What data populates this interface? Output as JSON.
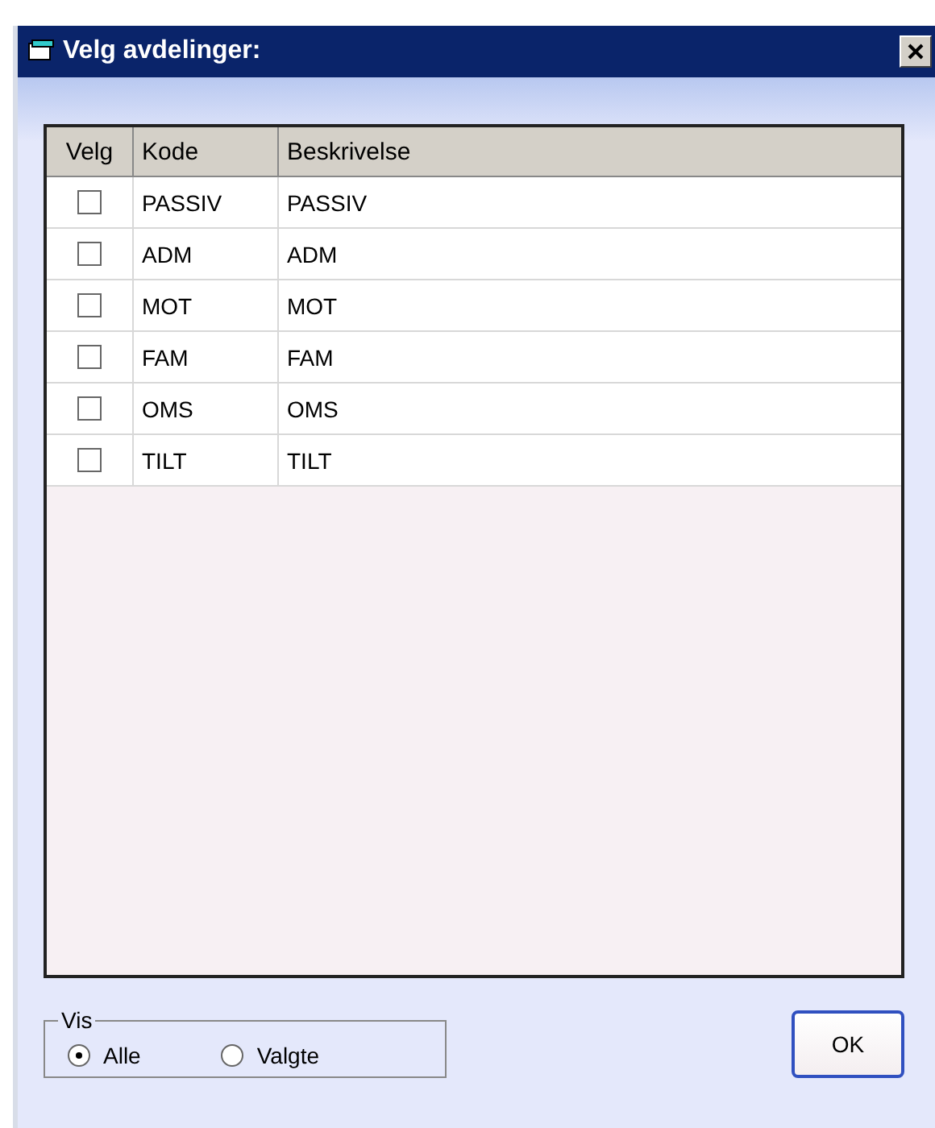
{
  "window": {
    "title": "Velg avdelinger:"
  },
  "table": {
    "columns": [
      "Velg",
      "Kode",
      "Beskrivelse"
    ],
    "rows": [
      {
        "checked": false,
        "code": "PASSIV",
        "description": "PASSIV"
      },
      {
        "checked": false,
        "code": "ADM",
        "description": "ADM"
      },
      {
        "checked": false,
        "code": "MOT",
        "description": "MOT"
      },
      {
        "checked": false,
        "code": "FAM",
        "description": "FAM"
      },
      {
        "checked": false,
        "code": "OMS",
        "description": "OMS"
      },
      {
        "checked": false,
        "code": "TILT",
        "description": "TILT"
      }
    ]
  },
  "vis": {
    "label": "Vis",
    "options": [
      {
        "label": "Alle",
        "selected": true
      },
      {
        "label": "Valgte",
        "selected": false
      }
    ]
  },
  "buttons": [
    "OK"
  ]
}
